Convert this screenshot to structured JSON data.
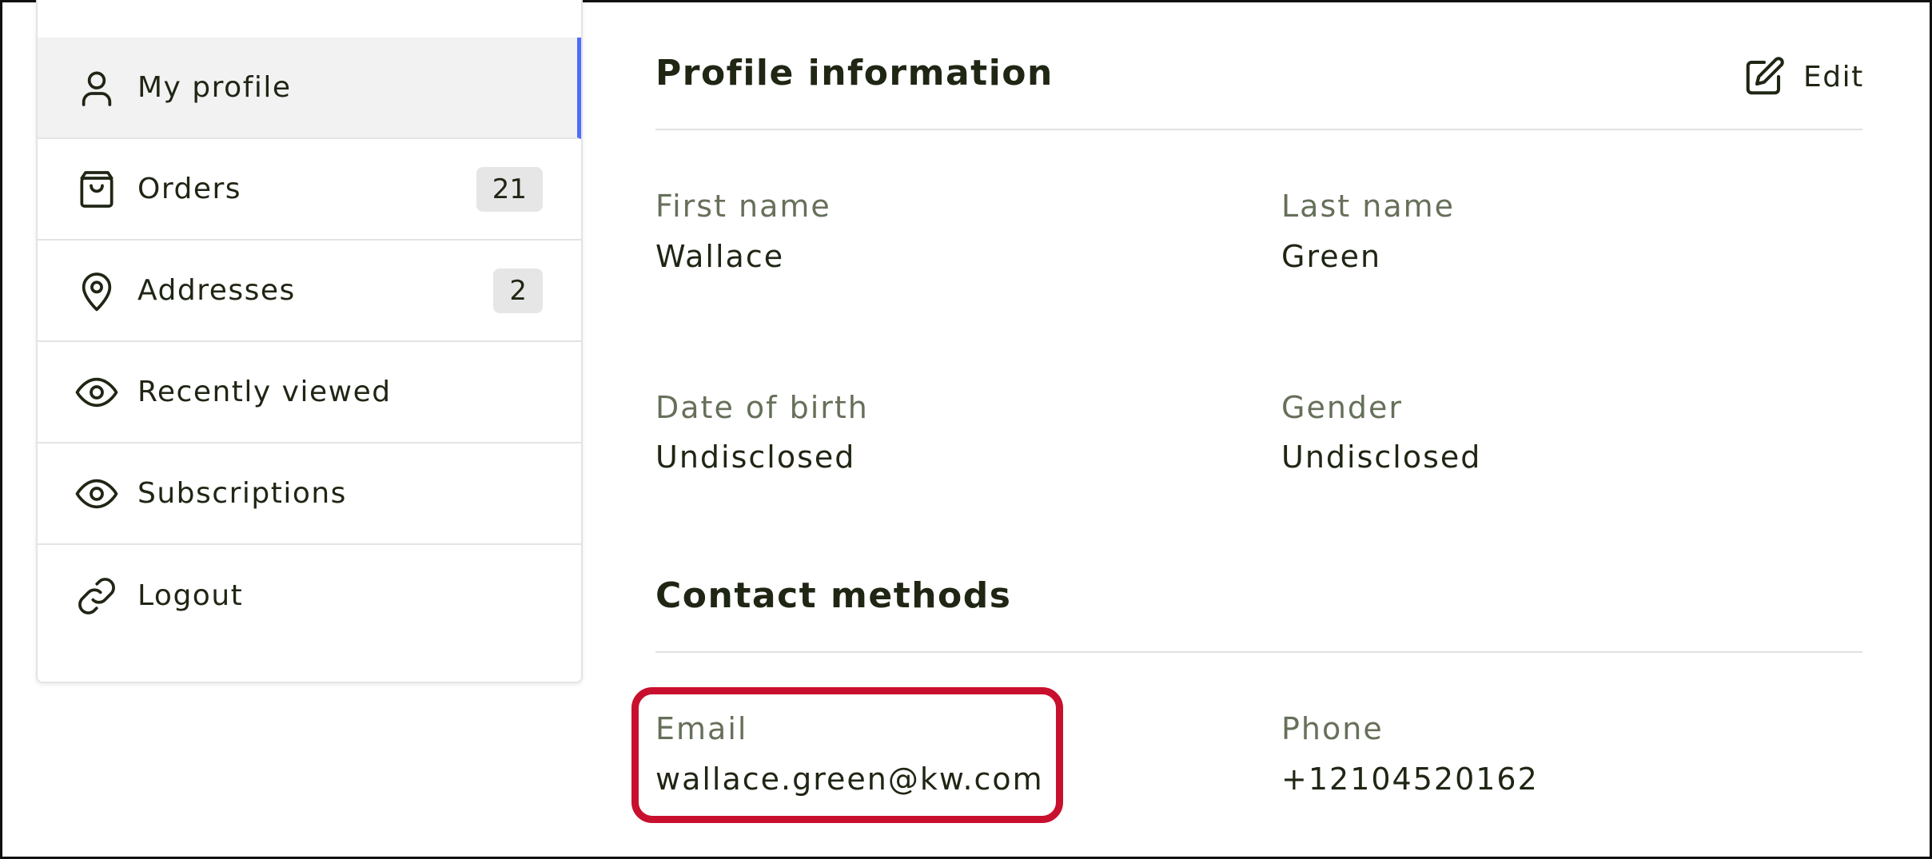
{
  "sidebar": {
    "items": [
      {
        "label": "My profile",
        "icon": "user-icon",
        "badge": null,
        "active": true
      },
      {
        "label": "Orders",
        "icon": "shopping-bag-icon",
        "badge": "21",
        "active": false
      },
      {
        "label": "Addresses",
        "icon": "map-pin-icon",
        "badge": "2",
        "active": false
      },
      {
        "label": "Recently viewed",
        "icon": "eye-icon",
        "badge": null,
        "active": false
      },
      {
        "label": "Subscriptions",
        "icon": "eye-icon",
        "badge": null,
        "active": false
      },
      {
        "label": "Logout",
        "icon": "link-icon",
        "badge": null,
        "active": false
      }
    ],
    "active_accent": "#4f6ef7"
  },
  "profile": {
    "title": "Profile information",
    "edit_label": "Edit",
    "first_name_label": "First name",
    "first_name": "Wallace",
    "last_name_label": "Last name",
    "last_name": "Green",
    "dob_label": "Date of birth",
    "dob": "Undisclosed",
    "gender_label": "Gender",
    "gender": "Undisclosed"
  },
  "contact": {
    "title": "Contact methods",
    "email_label": "Email",
    "email": "wallace.green@kw.com",
    "phone_label": "Phone",
    "phone": "+12104520162"
  },
  "colors": {
    "text": "#1f2614",
    "label": "#66705a",
    "highlight": "#c8102e"
  }
}
